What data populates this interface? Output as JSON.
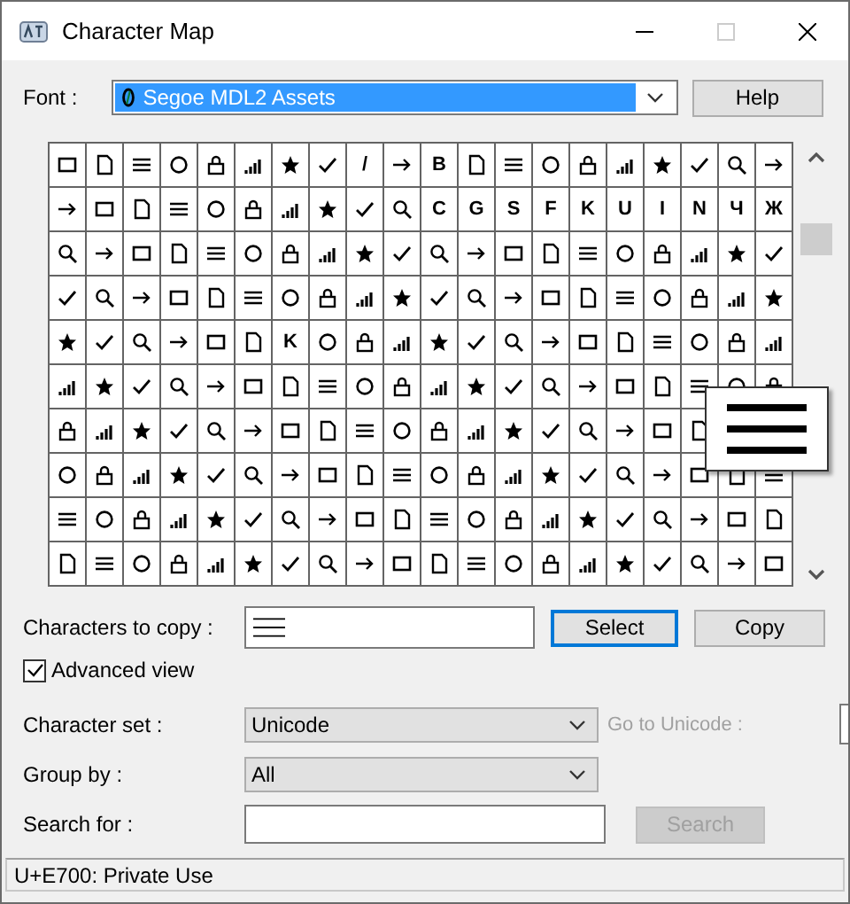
{
  "window": {
    "title": "Character Map"
  },
  "font": {
    "label": "Font :",
    "value": "Segoe MDL2 Assets",
    "highlighted": true
  },
  "help_button": "Help",
  "character_grid": {
    "rows": [
      [
        null,
        null,
        null,
        null,
        null,
        null,
        null,
        null,
        "/",
        null,
        "B",
        null,
        null,
        null,
        null,
        null,
        null,
        null,
        null,
        null
      ],
      [
        null,
        null,
        null,
        null,
        null,
        null,
        null,
        null,
        null,
        null,
        "C",
        "G",
        "S",
        "F",
        "K",
        "U",
        "I",
        "N",
        "Ч",
        "Ж"
      ],
      [
        null,
        null,
        null,
        null,
        null,
        null,
        null,
        null,
        null,
        null,
        null,
        null,
        null,
        null,
        null,
        null,
        null,
        null,
        null,
        null
      ],
      [
        null,
        null,
        null,
        null,
        null,
        null,
        null,
        null,
        null,
        null,
        null,
        null,
        null,
        null,
        null,
        null,
        null,
        null,
        null,
        null
      ],
      [
        null,
        null,
        null,
        null,
        null,
        null,
        "K",
        null,
        null,
        null,
        null,
        null,
        null,
        null,
        null,
        null,
        null,
        null,
        null,
        null
      ],
      [
        null,
        null,
        null,
        null,
        null,
        null,
        null,
        null,
        null,
        null,
        null,
        null,
        null,
        null,
        null,
        null,
        null,
        null,
        null,
        null
      ],
      [
        null,
        null,
        null,
        null,
        null,
        null,
        null,
        null,
        null,
        null,
        null,
        null,
        null,
        null,
        null,
        null,
        null,
        null
      ],
      [
        null,
        null,
        null,
        null,
        null,
        null,
        null,
        null,
        null,
        null,
        null,
        null,
        null,
        null,
        null,
        null,
        null,
        null,
        null,
        null
      ],
      [
        null,
        null,
        null,
        null,
        null,
        null,
        null,
        null,
        null,
        null,
        null,
        null,
        null,
        null,
        null,
        null,
        null,
        null,
        null,
        null
      ],
      [
        null,
        null,
        null,
        null,
        null,
        null,
        null,
        null,
        null,
        null,
        null,
        null,
        null,
        null,
        null,
        null,
        null,
        null,
        null,
        null
      ]
    ]
  },
  "copy": {
    "label": "Characters to copy :"
  },
  "select_button": {
    "label": "Select",
    "focused": true
  },
  "copy_button": "Copy",
  "advanced_view": {
    "label": "Advanced view",
    "checked": true
  },
  "character_set": {
    "label": "Character set :",
    "value": "Unicode"
  },
  "go_to_unicode": {
    "label": "Go to Unicode :",
    "disabled": true
  },
  "group_by": {
    "label": "Group by :",
    "value": "All"
  },
  "search": {
    "label": "Search for :",
    "button": "Search",
    "button_disabled": true
  },
  "status_bar": "U+E700: Private Use"
}
